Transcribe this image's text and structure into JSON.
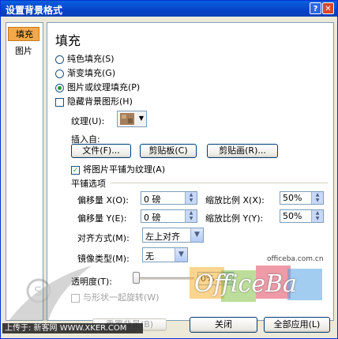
{
  "window": {
    "title": "设置背景格式",
    "help": "?",
    "close": "✕"
  },
  "nav": {
    "items": [
      {
        "label": "填充"
      },
      {
        "label": "图片"
      }
    ]
  },
  "fill": {
    "heading": "填充",
    "options": [
      "纯色填充(S)",
      "渐变填充(G)",
      "图片或纹理填充(P)"
    ],
    "selected_index": 2,
    "hide_bg_label": "隐藏背景图形(H)",
    "texture_label": "纹理(U):",
    "insert_from_label": "插入自:",
    "insert_buttons": [
      "文件(F)...",
      "剪贴板(C)",
      "剪贴画(R)..."
    ],
    "tile_label": "将图片平铺为纹理(A)",
    "tile_checked": true,
    "tile_options_label": "平铺选项",
    "offset_x_label": "偏移量 X(O):",
    "offset_x_value": "0 磅",
    "scale_x_label": "缩放比例 X(X):",
    "scale_x_value": "50%",
    "offset_y_label": "偏移量 Y(E):",
    "offset_y_value": "0 磅",
    "scale_y_label": "缩放比例 Y(Y):",
    "scale_y_value": "50%",
    "align_label": "对齐方式(M):",
    "align_value": "左上对齐",
    "mirror_label": "镜像类型(M):",
    "mirror_value": "无",
    "transparency_label": "透明度(T):",
    "transparency_value": "0%",
    "transparency_fraction": 0.0,
    "rotate_label": "与形状一起旋转(W)"
  },
  "footer": {
    "reset": "重置背景(B)",
    "close": "关闭",
    "apply_all": "全部应用(L)"
  },
  "watermarks": {
    "site": "officeba.com.cn",
    "logo": "OfficeBa",
    "upload": "上传于: 新客网 WWW.XKER.COM"
  },
  "colors": {
    "accent": "#0A5FDF",
    "selection": "#F3A94A"
  }
}
